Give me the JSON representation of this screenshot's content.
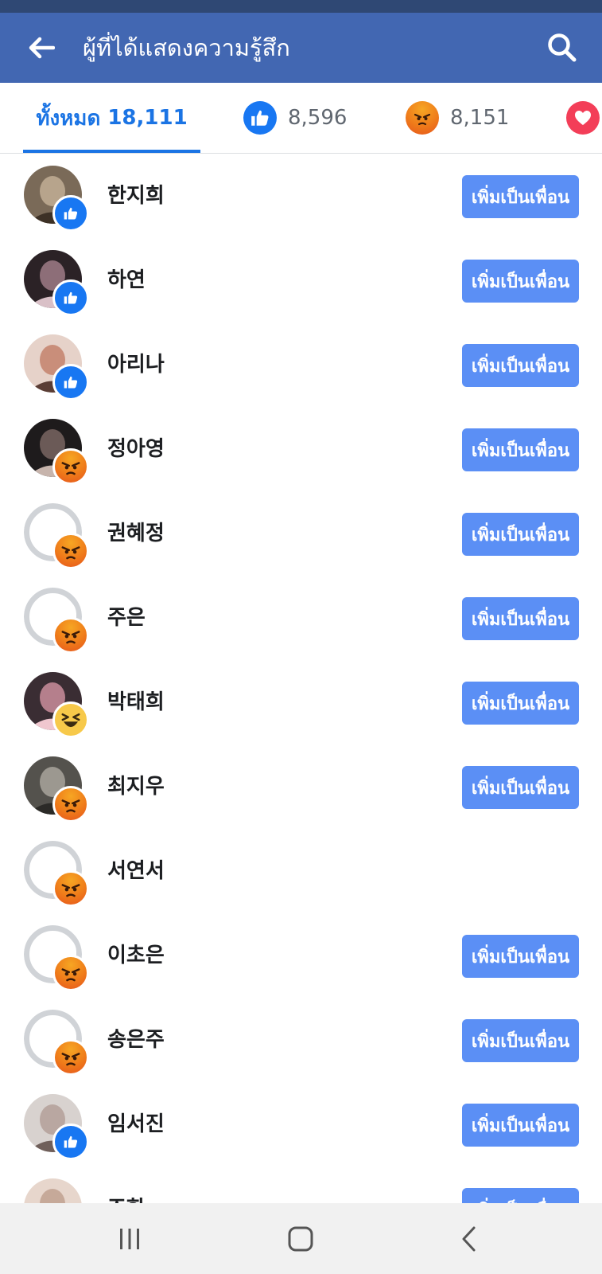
{
  "header": {
    "title": "ผู้ที่ได้แสดงความรู้สึก"
  },
  "tabs": {
    "all_label": "ทั้งหมด",
    "all_count": "18,111",
    "like_count": "8,596",
    "angry_count": "8,151"
  },
  "add_friend_label": "เพิ่มเป็นเพื่อน",
  "people": [
    {
      "name": "한지희",
      "reaction": "like-icon",
      "has_add_button": true
    },
    {
      "name": "하연",
      "reaction": "like-icon",
      "has_add_button": true
    },
    {
      "name": "아리나",
      "reaction": "like-icon",
      "has_add_button": true
    },
    {
      "name": "정아영",
      "reaction": "angry-icon",
      "has_add_button": true
    },
    {
      "name": "권혜정",
      "reaction": "angry-icon",
      "has_add_button": true
    },
    {
      "name": "주은",
      "reaction": "angry-icon",
      "has_add_button": true
    },
    {
      "name": "박태희",
      "reaction": "haha-icon",
      "has_add_button": true
    },
    {
      "name": "최지우",
      "reaction": "angry-icon",
      "has_add_button": true
    },
    {
      "name": "서연서",
      "reaction": "angry-icon",
      "has_add_button": false
    },
    {
      "name": "이초은",
      "reaction": "angry-icon",
      "has_add_button": true
    },
    {
      "name": "송은주",
      "reaction": "angry-icon",
      "has_add_button": true
    },
    {
      "name": "임서진",
      "reaction": "like-icon",
      "has_add_button": true
    },
    {
      "name": "조한",
      "reaction": "like-icon",
      "has_add_button": true
    }
  ],
  "colors": {
    "header_bg": "#4267b2",
    "status_bar": "#2f4874",
    "tab_active": "#1b74e4",
    "add_button": "#5b8ff5",
    "like": "#1877f2",
    "angry": "#ef7b1a",
    "love": "#f33e58"
  }
}
